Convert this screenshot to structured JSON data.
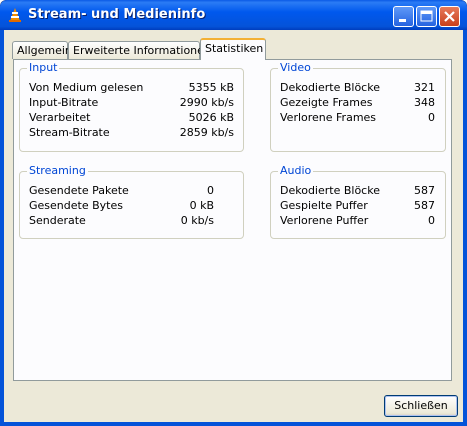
{
  "window": {
    "title": "Stream- und Medieninfo"
  },
  "tabs": [
    {
      "label": "Allgemein"
    },
    {
      "label": "Erweiterte Informationen"
    },
    {
      "label": "Statistiken"
    }
  ],
  "active_tab": "Statistiken",
  "groups": {
    "input": {
      "title": "Input",
      "rows": [
        {
          "label": "Von Medium gelesen",
          "value": "5355 kB"
        },
        {
          "label": "Input-Bitrate",
          "value": "2990 kb/s"
        },
        {
          "label": "Verarbeitet",
          "value": "5026 kB"
        },
        {
          "label": "Stream-Bitrate",
          "value": "2859 kb/s"
        }
      ]
    },
    "video": {
      "title": "Video",
      "rows": [
        {
          "label": "Dekodierte Blöcke",
          "value": "321"
        },
        {
          "label": "Gezeigte Frames",
          "value": "348"
        },
        {
          "label": "Verlorene Frames",
          "value": "0"
        }
      ]
    },
    "streaming": {
      "title": "Streaming",
      "rows": [
        {
          "label": "Gesendete Pakete",
          "value": "0"
        },
        {
          "label": "Gesendete Bytes",
          "value": "0 kB"
        },
        {
          "label": "Senderate",
          "value": "0 kb/s"
        }
      ]
    },
    "audio": {
      "title": "Audio",
      "rows": [
        {
          "label": "Dekodierte Blöcke",
          "value": "587"
        },
        {
          "label": "Gespielte Puffer",
          "value": "587"
        },
        {
          "label": "Verlorene Puffer",
          "value": "0"
        }
      ]
    }
  },
  "buttons": {
    "close_label": "Schließen"
  },
  "colors": {
    "titlebar": "#0058ee",
    "group_title": "#0046d5",
    "dialog_bg": "#ece9d8",
    "active_tab_accent": "#f3b034"
  },
  "icons": {
    "app": "vlc-cone-icon",
    "minimize": "minimize-icon",
    "maximize": "maximize-icon",
    "close": "close-icon"
  }
}
